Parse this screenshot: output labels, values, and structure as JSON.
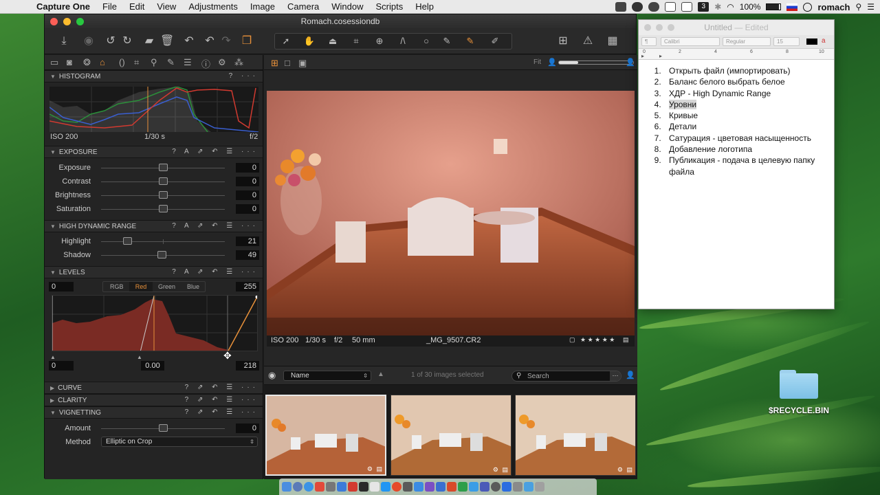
{
  "menubar": {
    "app_name": "Capture One",
    "items": [
      "File",
      "Edit",
      "View",
      "Adjustments",
      "Image",
      "Camera",
      "Window",
      "Scripts",
      "Help"
    ],
    "battery": "100%",
    "user": "romach",
    "badge": "3"
  },
  "window": {
    "title": "Romach.cosessiondb"
  },
  "viewbar": {
    "fit_label": "Fit"
  },
  "histogram": {
    "header": "HISTOGRAM",
    "iso": "ISO 200",
    "shutter": "1/30 s",
    "aperture": "f/2"
  },
  "exposure": {
    "header": "EXPOSURE",
    "rows": [
      {
        "label": "Exposure",
        "value": "0",
        "level": 0.5
      },
      {
        "label": "Contrast",
        "value": "0",
        "level": 0.5
      },
      {
        "label": "Brightness",
        "value": "0",
        "level": 0.5
      },
      {
        "label": "Saturation",
        "value": "0",
        "level": 0.5
      }
    ]
  },
  "hdr": {
    "header": "HIGH DYNAMIC RANGE",
    "rows": [
      {
        "label": "Highlight",
        "value": "21",
        "level": 0.21
      },
      {
        "label": "Shadow",
        "value": "49",
        "level": 0.49
      }
    ]
  },
  "levels": {
    "header": "LEVELS",
    "input_low": "0",
    "input_high": "255",
    "channels": [
      "RGB",
      "Red",
      "Green",
      "Blue"
    ],
    "active_channel": "Red",
    "output_low": "0",
    "midtone": "0.00",
    "output_high": "218"
  },
  "curve": {
    "header": "CURVE"
  },
  "clarity": {
    "header": "CLARITY"
  },
  "vignetting": {
    "header": "VIGNETTING",
    "amount_label": "Amount",
    "amount_value": "0",
    "amount_level": 0.5,
    "method_label": "Method",
    "method_value": "Elliptic on Crop"
  },
  "viewer": {
    "iso": "ISO 200",
    "shutter": "1/30 s",
    "aperture": "f/2",
    "focal": "50 mm",
    "filename": "_MG_9507.CR2",
    "stars": "★ ★ ★ ★ ★"
  },
  "browser": {
    "sort_label": "Name",
    "selection_status": "1 of 30 images selected",
    "search_placeholder": "Search"
  },
  "textedit": {
    "title": "Untitled",
    "status": "Edited",
    "font": "Calibri",
    "style": "Regular",
    "size": "15",
    "ruler": [
      "0",
      "2",
      "4",
      "6",
      "8",
      "10"
    ],
    "items": [
      "Открыть файл (импортировать)",
      "Баланс белого выбрать белое",
      "ХДР - High Dynamic Range",
      "Уровни",
      "Кривые",
      "Детали",
      "Сатурация - цветовая насыщенность",
      "Добавление логотипа",
      "Публикация - подача в целевую папку файла"
    ]
  },
  "desktop": {
    "recycle_label": "$RECYCLE.BIN"
  },
  "colors": {
    "accent_orange": "#e8913a",
    "levels_red": "#7a2b24",
    "selected_thumb": "#e8e8e8"
  }
}
